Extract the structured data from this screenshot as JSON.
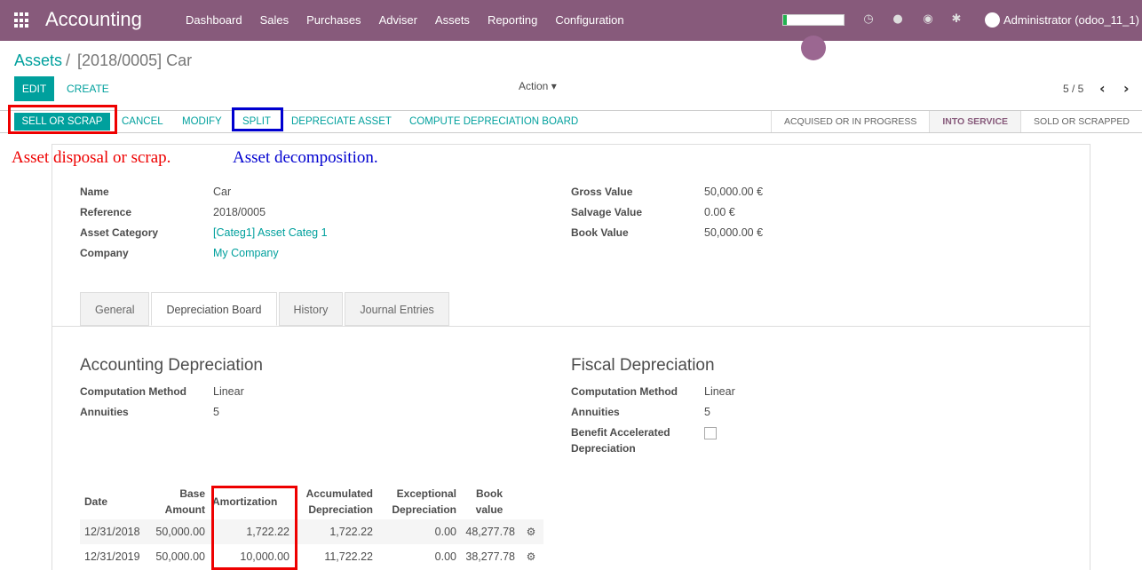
{
  "topbar": {
    "brand": "Accounting",
    "menu": [
      "Dashboard",
      "Sales",
      "Purchases",
      "Adviser",
      "Assets",
      "Reporting",
      "Configuration"
    ],
    "user": "Administrator (odoo_11_1)",
    "progress_fraction": 0.06
  },
  "breadcrumb": {
    "root": "Assets",
    "sep": "/",
    "current": "[2018/0005] Car"
  },
  "control": {
    "edit": "EDIT",
    "create": "CREATE",
    "action": "Action",
    "pager": "5 / 5"
  },
  "statusbar": {
    "buttons": [
      "SELL OR SCRAP",
      "CANCEL",
      "MODIFY",
      "SPLIT",
      "DEPRECIATE ASSET",
      "COMPUTE DEPRECIATION BOARD"
    ],
    "stages": [
      "ACQUISED OR IN PROGRESS",
      "INTO SERVICE",
      "SOLD OR SCRAPPED"
    ],
    "active_stage": "INTO SERVICE"
  },
  "annotations": {
    "red": "Asset disposal or scrap.",
    "blue": "Asset decomposition."
  },
  "form": {
    "left": [
      {
        "label": "Name",
        "value": "Car"
      },
      {
        "label": "Reference",
        "value": "2018/0005"
      },
      {
        "label": "Asset Category",
        "value": "[Categ1] Asset Categ 1"
      },
      {
        "label": "Company",
        "value": "My Company"
      }
    ],
    "right": [
      {
        "label": "Gross Value",
        "value": "50,000.00 €"
      },
      {
        "label": "Salvage Value",
        "value": "0.00 €"
      },
      {
        "label": "Book Value",
        "value": "50,000.00 €"
      }
    ]
  },
  "tabs": [
    "General",
    "Depreciation Board",
    "History",
    "Journal Entries"
  ],
  "accounting": {
    "title": "Accounting Depreciation",
    "method_label": "Computation Method",
    "method": "Linear",
    "annuities_label": "Annuities",
    "annuities": "5"
  },
  "fiscal": {
    "title": "Fiscal Depreciation",
    "method_label": "Computation Method",
    "method": "Linear",
    "annuities_label": "Annuities",
    "annuities": "5",
    "accel_label_1": "Benefit Accelerated",
    "accel_label_2": "Depreciation"
  },
  "table": {
    "headers": [
      [
        "Date",
        ""
      ],
      [
        "Base",
        "Amount"
      ],
      [
        "Amortization",
        ""
      ],
      [
        "Accumulated",
        "Depreciation"
      ],
      [
        "Exceptional",
        "Depreciation"
      ],
      [
        "Book",
        "value"
      ]
    ],
    "rows": [
      [
        "12/31/2018",
        "50,000.00",
        "1,722.22",
        "1,722.22",
        "0.00",
        "48,277.78"
      ],
      [
        "12/31/2019",
        "50,000.00",
        "10,000.00",
        "11,722.22",
        "0.00",
        "38,277.78"
      ]
    ]
  }
}
